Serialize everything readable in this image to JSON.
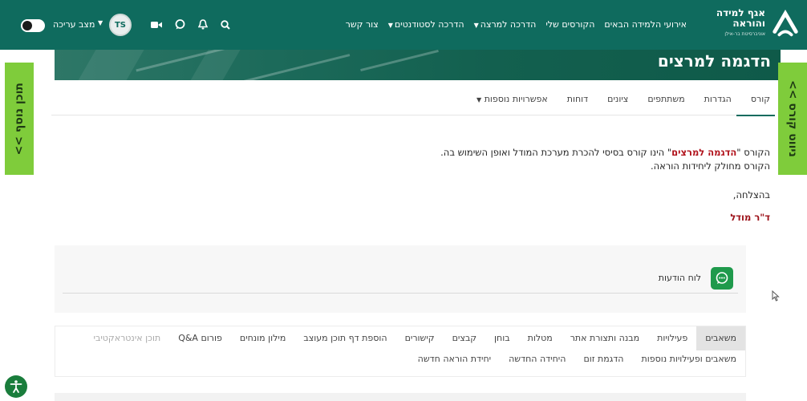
{
  "brand": {
    "line1": "אגף למידה",
    "line2": "והוראה",
    "sub": "אוניברסיטת בר-אילן",
    "color": "#0f6b5e"
  },
  "nav": {
    "items": [
      {
        "label": "אירועי הלמידה הבאים",
        "dropdown": false
      },
      {
        "label": "הקורסים שלי",
        "dropdown": false
      },
      {
        "label": "הדרכה למרצה",
        "dropdown": true
      },
      {
        "label": "הדרכה לסטודנטים",
        "dropdown": true
      },
      {
        "label": "צור קשר",
        "dropdown": false
      }
    ],
    "icons": [
      "search-icon",
      "bell-icon",
      "chat-icon",
      "video-icon"
    ]
  },
  "user": {
    "initials": "TS",
    "edit_mode_label": "מצב עריכה",
    "edit_mode_on": false
  },
  "course": {
    "title": "הדגמה למרצים"
  },
  "drawers": {
    "left": "תוכן נוסף >>",
    "right": "ניווט קורס >>",
    "accent": "#7fcc3b"
  },
  "tabs": [
    {
      "label": "קורס",
      "active": true
    },
    {
      "label": "הגדרות",
      "active": false
    },
    {
      "label": "משתתפים",
      "active": false
    },
    {
      "label": "ציונים",
      "active": false
    },
    {
      "label": "דוחות",
      "active": false
    },
    {
      "label": "אפשרויות נוספות",
      "active": false,
      "dropdown": true
    }
  ],
  "description": {
    "prefix": "הקורס \"",
    "highlight": "הדגמה למרצים",
    "suffix": "\" הינו קורס בסיסי להכרת מערכת המודל ואופן השימוש בה.",
    "line2": "הקורס מחולק ליחידות הוראה.",
    "greeting": "בהצלחה,",
    "signature": "ד\"ר מודל"
  },
  "forum": {
    "label": "לוח הודעות",
    "icon": "forum-icon"
  },
  "activities": {
    "row1": [
      {
        "label": "משאבים",
        "active": true
      },
      {
        "label": "פעילויות"
      },
      {
        "label": "מבנה ותצורת אתר"
      },
      {
        "label": "מטלות"
      },
      {
        "label": "בוחן"
      },
      {
        "label": "קבצים"
      },
      {
        "label": "קישורים"
      },
      {
        "label": "הוספת דף תוכן מעוצב"
      },
      {
        "label": "מילון מונחים"
      },
      {
        "label": "פורום Q&A"
      },
      {
        "label": "תוכן אינטראקטיבי",
        "muted": true
      }
    ],
    "row2": [
      {
        "label": "משאבים ופעילויות נוספות"
      },
      {
        "label": "הדגמת זום"
      },
      {
        "label": "היחידה החדשה"
      },
      {
        "label": "יחידת הוראה חדשה"
      }
    ]
  }
}
